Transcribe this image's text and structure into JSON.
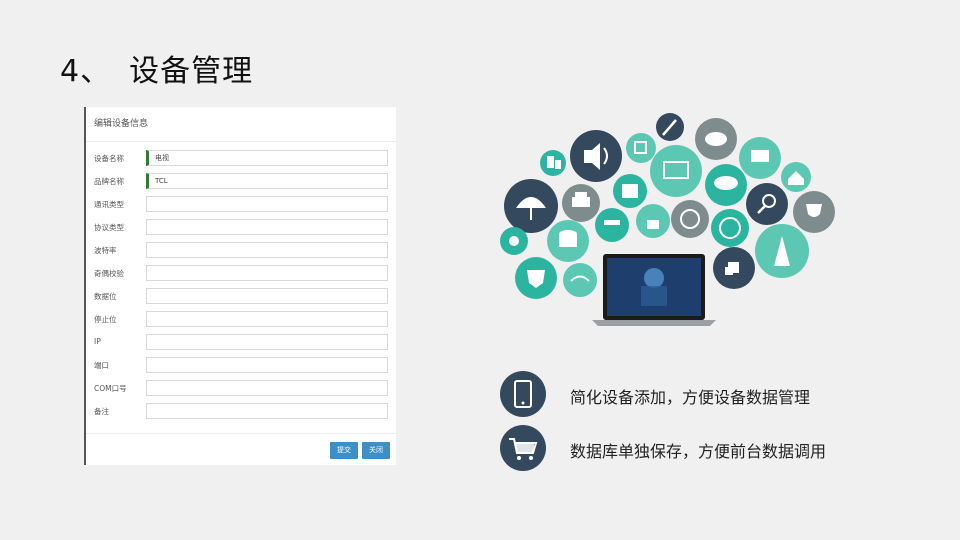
{
  "slide": {
    "number": "4、",
    "title": "设备管理"
  },
  "form": {
    "header": "编辑设备信息",
    "fields": [
      {
        "label": "设备名称",
        "value": "电视"
      },
      {
        "label": "品牌名称",
        "value": "TCL"
      },
      {
        "label": "通讯类型",
        "value": ""
      },
      {
        "label": "协议类型",
        "value": ""
      },
      {
        "label": "波特率",
        "value": ""
      },
      {
        "label": "奇偶校验",
        "value": ""
      },
      {
        "label": "数据位",
        "value": ""
      },
      {
        "label": "停止位",
        "value": ""
      },
      {
        "label": "IP",
        "value": ""
      },
      {
        "label": "端口",
        "value": ""
      },
      {
        "label": "COM口号",
        "value": ""
      },
      {
        "label": "备注",
        "value": ""
      }
    ],
    "submit_label": "提交",
    "close_label": "关闭"
  },
  "features": [
    {
      "icon": "smartphone-icon",
      "text": "简化设备添加，方便设备数据管理"
    },
    {
      "icon": "shopping-cart-icon",
      "text": "数据库单独保存，方便前台数据调用"
    }
  ],
  "colors": {
    "dark_navy": "#34495e",
    "teal": "#2bb5a0",
    "light_teal": "#5cc7b2",
    "gray": "#7f8c8d",
    "button_blue": "#3d8fc7",
    "field_accent": "#2e7d32"
  }
}
